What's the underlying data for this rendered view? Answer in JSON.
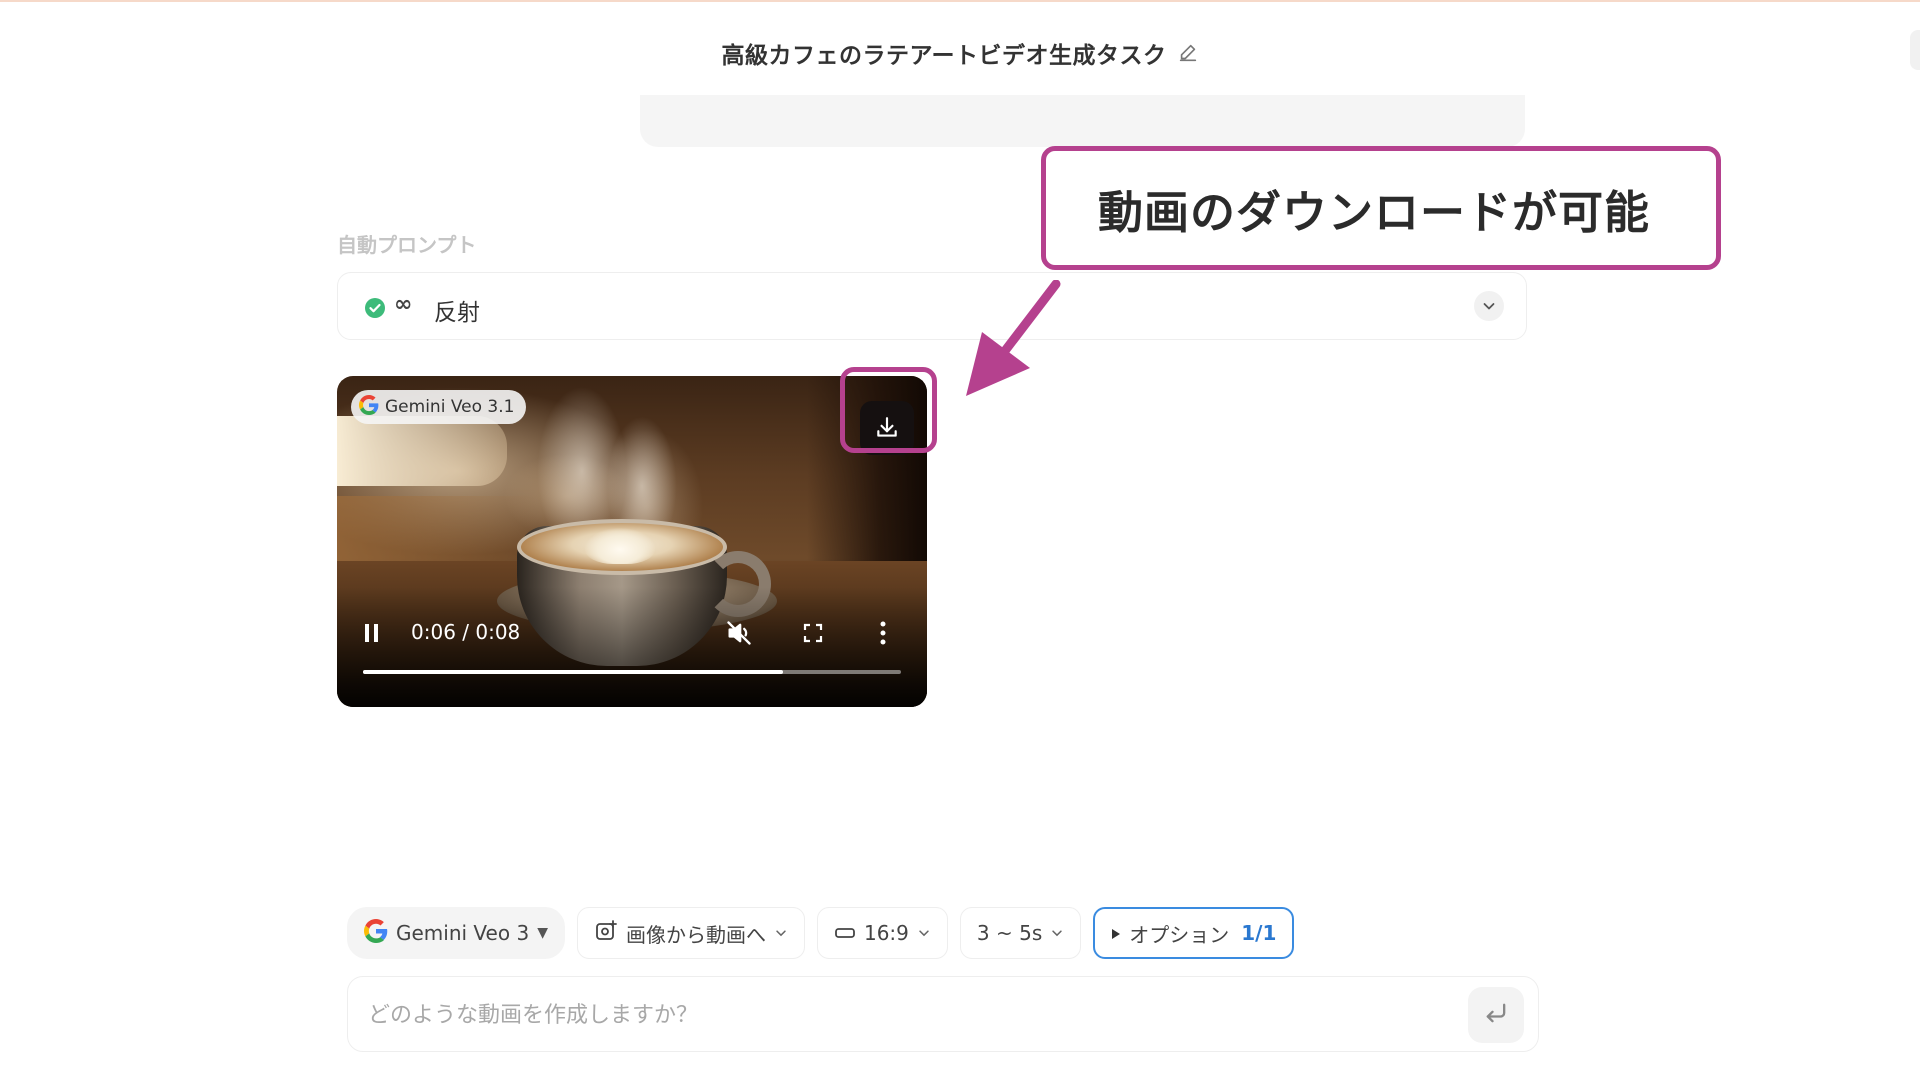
{
  "header": {
    "title": "高級カフェのラテアートビデオ生成タスク",
    "edit_icon": "pencil-icon"
  },
  "auto_prompt": {
    "section_label": "自動プロンプト",
    "status_icon": "check-circle-icon",
    "loop_icon": "∞",
    "label": "反射",
    "toggle_icon": "chevron-down-icon"
  },
  "video": {
    "model_badge": "Gemini Veo 3.1",
    "download_icon": "download-icon",
    "time_display": "0:06 / 0:08",
    "progress": 0.78,
    "muted": true
  },
  "annotation": {
    "callout_text": "動画のダウンロードが可能",
    "color": "#b5418e"
  },
  "toolbar": {
    "model": "Gemini Veo 3",
    "mode": "画像から動画へ",
    "aspect_ratio": "16:9",
    "duration": "3 ~ 5s",
    "options_label": "オプション",
    "options_count": "1/1"
  },
  "composer": {
    "placeholder": "どのような動画を作成しますか？",
    "send_icon": "enter-icon"
  },
  "colors": {
    "accent_blue": "#3a8be0",
    "success_green": "#3dbb7a",
    "highlight_magenta": "#b5418e"
  }
}
